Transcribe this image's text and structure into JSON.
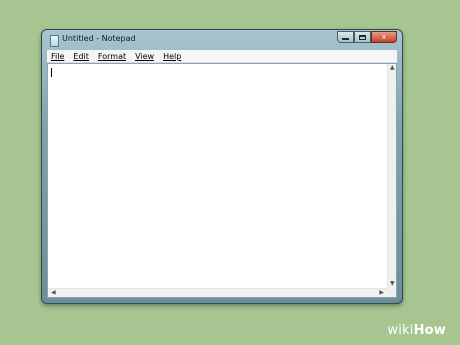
{
  "window": {
    "title": "Untitled - Notepad",
    "caption_buttons": {
      "minimize_icon": "minimize-icon",
      "maximize_icon": "maximize-icon",
      "close_icon": "close-icon",
      "close_glyph": "x"
    }
  },
  "menubar": {
    "items": [
      {
        "label": "File"
      },
      {
        "label": "Edit"
      },
      {
        "label": "Format"
      },
      {
        "label": "View"
      },
      {
        "label": "Help"
      }
    ]
  },
  "editor": {
    "text": ""
  },
  "watermark": {
    "wiki": "wiki",
    "how": "How"
  },
  "colors": {
    "background": "#a6c591",
    "window_frame": "#7fa3ae",
    "close_button": "#c6422b"
  }
}
